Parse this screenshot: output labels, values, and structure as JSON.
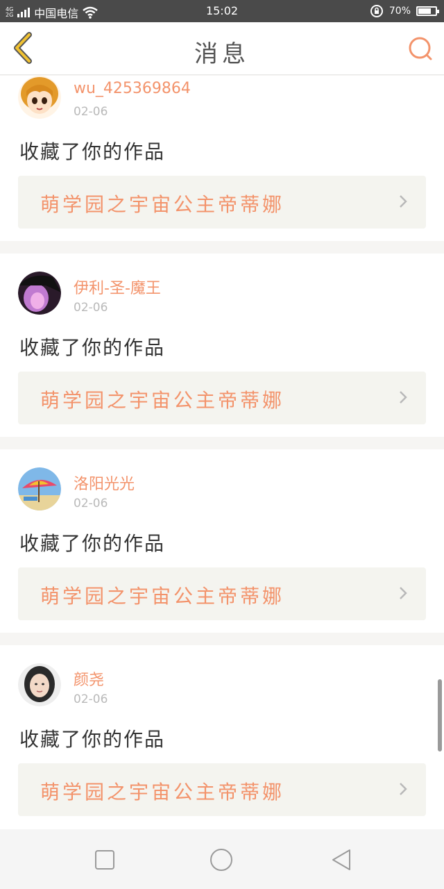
{
  "status_bar": {
    "network_top": "4G",
    "network_bottom": "2G",
    "carrier": "中国电信",
    "time": "15:02",
    "battery": "70%",
    "battery_level": 0.7
  },
  "header": {
    "title": "消息",
    "back_icon": "chevron-left-icon",
    "search_icon": "search-icon"
  },
  "messages": [
    {
      "username": "wu_425369864",
      "date": "02-06",
      "action": "收藏了你的作品",
      "work_title": "萌学园之宇宙公主帝蒂娜"
    },
    {
      "username": "伊利-圣-魔王",
      "date": "02-06",
      "action": "收藏了你的作品",
      "work_title": "萌学园之宇宙公主帝蒂娜"
    },
    {
      "username": "洛阳光光",
      "date": "02-06",
      "action": "收藏了你的作品",
      "work_title": "萌学园之宇宙公主帝蒂娜"
    },
    {
      "username": "颜尧",
      "date": "02-06",
      "action": "收藏了你的作品",
      "work_title": "萌学园之宇宙公主帝蒂娜"
    }
  ],
  "colors": {
    "accent": "#f3936b",
    "back_arrow": "#f1c232",
    "card_bg": "#ffffff",
    "work_bg": "#f4f4ef"
  },
  "nav_icons": [
    "square-recent-icon",
    "circle-home-icon",
    "triangle-back-icon"
  ]
}
